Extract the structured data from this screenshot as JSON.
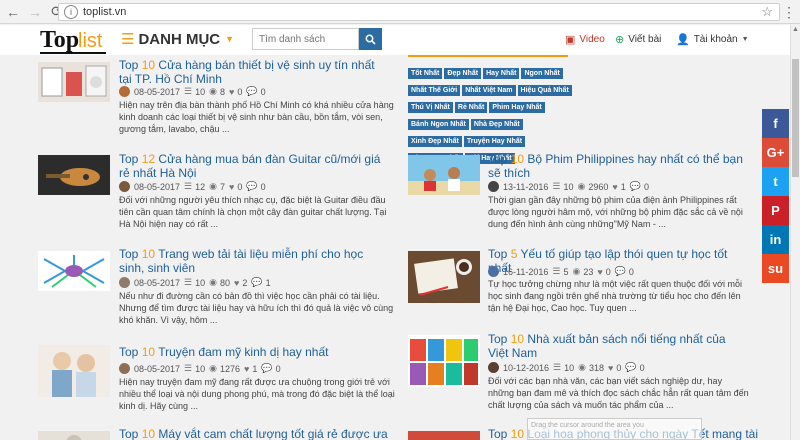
{
  "browser": {
    "url": "toplist.vn"
  },
  "header": {
    "logo_top": "Top",
    "logo_list": "list",
    "menu_label": "DANH MỤC",
    "search_placeholder": "Tìm danh sách",
    "video": "Video",
    "write": "Viết bài",
    "account": "Tài khoản",
    "colors": {
      "accent": "#f39c12",
      "brand_blue": "#2d6ca2"
    }
  },
  "tags": [
    "Tốt Nhất",
    "Đẹp Nhất",
    "Hay Nhất",
    "Ngon Nhất",
    "Nhất Thế Giới",
    "Nhất Việt Nam",
    "Hiệu Quả Nhất",
    "Thú Vị Nhất",
    "Rẻ Nhất",
    "Phim Hay Nhất",
    "Bánh Ngon Nhất",
    "Nhà Đẹp Nhất",
    "Xinh Đẹp Nhất",
    "Truyện Hay Nhất",
    "Nhạc Hay Nhất",
    "Hài Hay Nhất"
  ],
  "articles": [
    {
      "top": "Top",
      "num": "10",
      "title": "Cửa hàng bán thiết bị vệ sinh uy tín nhất tại TP. Hồ Chí Minh",
      "date": "08-05-2017",
      "items": "10",
      "views": "8",
      "likes": "0",
      "comments": "0",
      "desc": "Hiện nay trên địa bàn thành phố Hồ Chí Minh có khá nhiều cửa hàng kinh doanh các loại thiết bị vệ sinh như bàn cầu, bồn tắm, vòi sen, gương tắm, lavabo, chậu ..."
    },
    {
      "top": "Top",
      "num": "12",
      "title": "Cửa hàng mua bán đàn Guitar cũ/mới giá rẻ nhất Hà Nội",
      "date": "08-05-2017",
      "items": "12",
      "views": "7",
      "likes": "0",
      "comments": "0",
      "desc": "Đối với những người yêu thích nhạc cụ, đặc biệt là Guitar điều đầu tiên cần quan tâm chính là chọn một cây đàn guitar chất lượng. Tại Hà Nội hiện nay có rất ..."
    },
    {
      "top": "Top",
      "num": "10",
      "title": "Bộ Phim Philippines hay nhất có thể bạn sẽ thích",
      "date": "13-11-2016",
      "items": "10",
      "views": "2960",
      "likes": "1",
      "comments": "0",
      "desc": "Thời gian gần đây những bộ phim của điện ảnh Philippines rất được lòng người hâm mộ, với những bộ phim đặc sắc cả về nội dung đến hình ảnh cùng những\"Mỹ Nam - ..."
    },
    {
      "top": "Top",
      "num": "10",
      "title": "Trang web tải tài liệu miễn phí cho học sinh, sinh viên",
      "date": "08-05-2017",
      "items": "10",
      "views": "80",
      "likes": "2",
      "comments": "1",
      "desc": "Nếu như đi đường cần có bản đồ thì việc học cần phải có tài liệu. Nhưng để tìm được tài liệu hay và hữu ích thì đó quả là việc vô cùng khó khăn. Vì vậy, hôm ..."
    },
    {
      "top": "Top",
      "num": "5",
      "title": "Yếu tố giúp tạo lập thói quen tự học tốt nhất",
      "date": "16-11-2016",
      "items": "5",
      "views": "23",
      "likes": "0",
      "comments": "0",
      "desc": "Tự học tưởng chừng như là một việc rất quen thuộc đối với mỗi học sinh đang ngồi trên ghế nhà trường từ tiểu học cho đến lên tận hệ Đại học, Cao học. Tuy quen ..."
    },
    {
      "top": "Top",
      "num": "10",
      "title": "Truyện đam mỹ kinh dị hay nhất",
      "date": "08-05-2017",
      "items": "10",
      "views": "1276",
      "likes": "1",
      "comments": "0",
      "desc": "Hiện nay truyện đam mỹ đang rất được ưa chuộng trong giới trẻ với nhiều thể loại và nội dung phong phú, mà trong đó đặc biệt là thể loại kinh dị. Hãy cùng ..."
    },
    {
      "top": "Top",
      "num": "10",
      "title": "Nhà xuất bản sách nổi tiếng nhất của Việt Nam",
      "date": "10-12-2016",
      "items": "10",
      "views": "318",
      "likes": "0",
      "comments": "0",
      "desc": "Đối với các bạn nhà văn, các bạn viết sách nghiệp dư, hay những bạn đam mê và thích đọc sách chắc hẳn rất quan tâm đến chất lượng của sách và muốn tác phẩm của ..."
    },
    {
      "top": "Top",
      "num": "10",
      "title": "Máy vắt cam chất lượng tốt giá rẻ được ưa"
    },
    {
      "top": "Top",
      "num": "10",
      "title": "Loại hoa phong thủy cho ngày Tết mang tài"
    }
  ],
  "social": [
    "f",
    "G+",
    "t",
    "P",
    "in",
    "su"
  ],
  "drag_hint": "Drag the cursor around the area you"
}
